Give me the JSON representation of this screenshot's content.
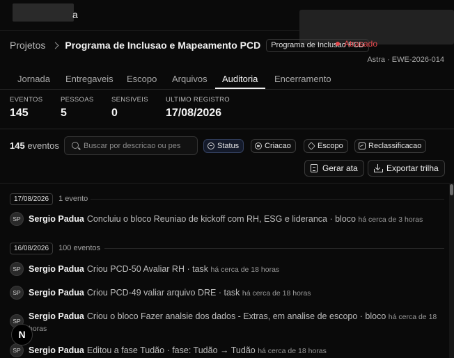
{
  "app": {
    "brand_suffix": "a"
  },
  "breadcrumb": {
    "root": "Projetos",
    "title": "Programa de Inclusao e Mapeamento PCD",
    "chip": "Programa de Inclusao PCD",
    "status": "Atrasado"
  },
  "project": {
    "meta": "Astra · EWE-2026-014"
  },
  "tabs": [
    {
      "label": "Jornada",
      "active": false
    },
    {
      "label": "Entregaveis",
      "active": false
    },
    {
      "label": "Escopo",
      "active": false
    },
    {
      "label": "Arquivos",
      "active": false
    },
    {
      "label": "Auditoria",
      "active": true
    },
    {
      "label": "Encerramento",
      "active": false
    }
  ],
  "stats": [
    {
      "label": "EVENTOS",
      "value": "145"
    },
    {
      "label": "PESSOAS",
      "value": "5"
    },
    {
      "label": "SENSIVEIS",
      "value": "0"
    },
    {
      "label": "ULTIMO REGISTRO",
      "value": "17/08/2026"
    }
  ],
  "toolbar": {
    "count_value": "145",
    "count_label": "eventos",
    "search_placeholder": "Buscar por descricao ou pes",
    "filters": [
      {
        "label": "Status",
        "icon": "status-icon"
      },
      {
        "label": "Criacao",
        "icon": "plus-circle-icon"
      },
      {
        "label": "Escopo",
        "icon": "tag-icon"
      },
      {
        "label": "Reclassificacao",
        "icon": "image-icon"
      }
    ],
    "gerar_ata": "Gerar ata",
    "exportar_trilha": "Exportar trilha"
  },
  "groups": [
    {
      "date": "17/08/2026",
      "count": "1 evento",
      "events": [
        {
          "initials": "SP",
          "actor": "Sergio Padua",
          "action": "Concluiu o bloco Reuniao de kickoff com RH, ESG e lideranca · bloco",
          "time": "há cerca de 3 horas"
        }
      ]
    },
    {
      "date": "16/08/2026",
      "count": "100 eventos",
      "events": [
        {
          "initials": "SP",
          "actor": "Sergio Padua",
          "action": "Criou PCD-50 Avaliar RH · task",
          "time": "há cerca de 18 horas"
        },
        {
          "initials": "SP",
          "actor": "Sergio Padua",
          "action": "Criou PCD-49 valiar arquivo DRE · task",
          "time": "há cerca de 18 horas"
        },
        {
          "initials": "SP",
          "actor": "Sergio Padua",
          "action": "Criou o bloco Fazer analsie dos dados - Extras, em analise de escopo · bloco",
          "time": "há cerca de 18 horas"
        },
        {
          "initials": "SP",
          "actor": "Sergio Padua",
          "action": "Editou a fase Tudão · fase: Tudão → Tudão",
          "time": "há cerca de 18 horas"
        }
      ]
    }
  ],
  "next_badge": "N"
}
